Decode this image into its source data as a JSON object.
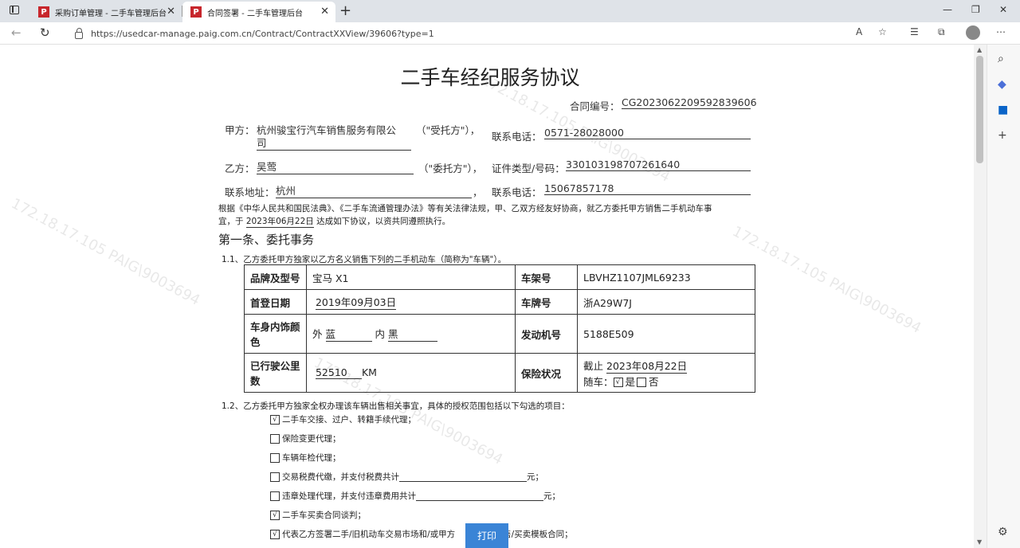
{
  "browser": {
    "tabs": [
      {
        "icon": "P",
        "title": "采购订单管理 - 二手车管理后台",
        "active": false
      },
      {
        "icon": "P",
        "title": "合同签署 - 二手车管理后台",
        "active": true
      }
    ],
    "url": "https://usedcar-manage.paig.com.cn/Contract/ContractXXView/39606?type=1"
  },
  "watermark": "172.18.17.105 PAIG\\9003694",
  "doc": {
    "title": "二手车经纪服务协议",
    "contract_no_label": "合同编号：",
    "contract_no": "CG2023062209592839606",
    "party_a_label": "甲方：",
    "party_a_name_1": "杭州骏宝行汽车销售服务有限公",
    "party_a_name_2": "司",
    "party_a_role": "（\"受托方\"），",
    "phone_label": "联系电话：",
    "party_a_phone": "0571-28028000",
    "party_b_label": "乙方：",
    "party_b_name": "吴莺",
    "party_b_role": "（\"委托方\"），",
    "id_label": "证件类型/号码：",
    "party_b_id": "330103198707261640",
    "address_label": "联系地址：",
    "party_b_address": "杭州",
    "comma": "，",
    "party_b_phone": "15067857178",
    "preamble_1": "根据《中华人民共和国民法典》、《二手车流通管理办法》等有关法律法规，甲、乙双方经友好协商，就乙方委托甲方销售二手机动车事",
    "preamble_2a": "宜，于",
    "preamble_date": "2023年06月22日",
    "preamble_2b": "达成如下协议，以资共同遵照执行。",
    "section1": "第一条、委托事务",
    "clause_1_1": "1.1、乙方委托甲方独家以乙方名义销售下列的二手机动车（简称为\"车辆\"）。",
    "clause_1_2": "1.2、乙方委托甲方独家全权办理该车辆出售相关事宜，具体的授权范围包括以下勾选的项目："
  },
  "vehicle": {
    "brand_label": "品牌及型号",
    "brand": "宝马 X1",
    "vin_label": "车架号",
    "vin": "LBVHZ1107JML69233",
    "reg_label": "首登日期",
    "reg_date": "2019年09月03日",
    "plate_label": "车牌号",
    "plate": "浙A29W7J",
    "color_label_1": "车身内饰颜",
    "color_label_2": "色",
    "ext_label": "外",
    "ext_color": "蓝",
    "int_label": "内",
    "int_color": "黑",
    "engine_label": "发动机号",
    "engine": "5188E509",
    "mileage_label_1": "已行驶公里",
    "mileage_label_2": "数",
    "mileage": "52510",
    "mileage_unit": "KM",
    "insurance_label": "保险状况",
    "ins_until_label": "截止",
    "ins_until": "2023年08月22日",
    "ins_with_label": "随车：",
    "yes": "是",
    "no": "否"
  },
  "options": [
    {
      "checked": true,
      "text": "二手车交接、过户、转籍手续代理；"
    },
    {
      "checked": false,
      "text": "保险变更代理；"
    },
    {
      "checked": false,
      "text": "车辆年检代理；"
    },
    {
      "checked": false,
      "text": "交易税费代缴，并支付税费共计",
      "suffix": "元；"
    },
    {
      "checked": false,
      "text": "违章处理代理，并支付违章费用共计",
      "suffix": "元；"
    },
    {
      "checked": true,
      "text": "二手车买卖合同谈判；"
    },
    {
      "checked": true,
      "text": "代表乙方签署二手/旧机动车交易市场和/或甲方",
      "suffix": "售/买卖模板合同；"
    }
  ],
  "print_label": "打印"
}
